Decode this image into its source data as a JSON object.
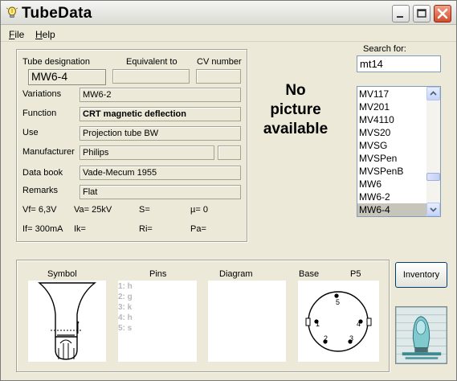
{
  "window": {
    "title": "TubeData"
  },
  "menu": {
    "file": "File",
    "file_key": "F",
    "file_rest": "ile",
    "help": "Help",
    "help_key": "H",
    "help_rest": "elp"
  },
  "details": {
    "designation_label": "Tube designation",
    "equivalent_label": "Equivalent to",
    "cv_label": "CV number",
    "designation": "MW6-4",
    "equivalent": "",
    "cv_number": "",
    "variations_label": "Variations",
    "variations": "MW6-2",
    "function_label": "Function",
    "function": "CRT magnetic deflection",
    "use_label": "Use",
    "use": "Projection tube BW",
    "manufacturer_label": "Manufacturer",
    "manufacturer": "Philips",
    "manufacturer_code": "",
    "databook_label": "Data book",
    "databook": "Vade-Mecum 1955",
    "remarks_label": "Remarks",
    "remarks": "Flat",
    "vf": "Vf= 6,3V",
    "va": "Va= 25kV",
    "s": "S=",
    "mu": "µ=   0",
    "if": "If= 300mA",
    "ik": "Ik=",
    "ri": "Ri=",
    "pa": "Pa="
  },
  "no_picture": [
    "No",
    "picture",
    "available"
  ],
  "search": {
    "label": "Search for:",
    "value": "mt14"
  },
  "tube_list": {
    "items": [
      "MV117",
      "MV201",
      "MV4110",
      "MVS20",
      "MVSG",
      "MVSPen",
      "MVSPenB",
      "MW6",
      "MW6-2",
      "MW6-4"
    ],
    "selected": "MW6-4"
  },
  "panels": {
    "symbol": "Symbol",
    "pins": "Pins",
    "diagram": "Diagram",
    "base": "Base",
    "base_code": "P5",
    "pin_list": [
      "1: h",
      "2: g",
      "3: k",
      "4: h",
      "5: s"
    ],
    "base_pins": [
      "5",
      "1",
      "4",
      "2",
      "3"
    ]
  },
  "inventory": {
    "label": "Inventory"
  },
  "colors": {
    "face": "#ece9d8",
    "selection": "#c7c5ba",
    "close_button": "#d54b2c",
    "list_border": "#7f9db9"
  },
  "icons": [
    "bulb-icon",
    "minimize-icon",
    "maximize-icon",
    "close-icon",
    "scroll-up-icon",
    "scroll-down-icon",
    "tube-logo-icon"
  ]
}
